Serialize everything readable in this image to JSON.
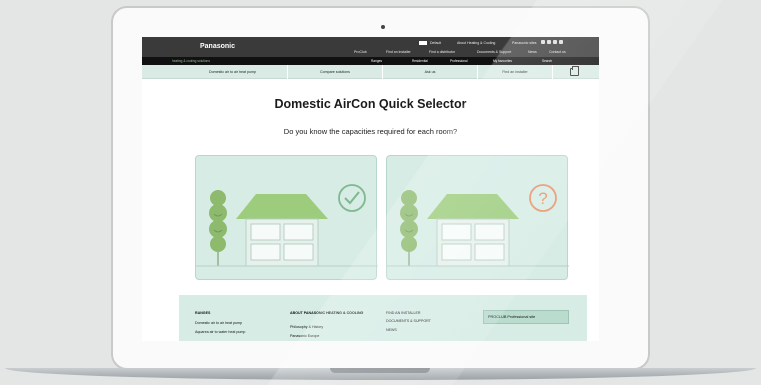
{
  "header": {
    "logo": "Panasonic",
    "top_links": [
      "Default",
      "About Heating & Cooling",
      "Panasonic sites"
    ],
    "secondary_links": [
      "ProClub",
      "Find an installer",
      "Find a distributor",
      "Documents & Support",
      "News",
      "Contact us"
    ],
    "tagline": "heating & cooling solutions",
    "sub_links": [
      "Ranges",
      "Residential",
      "Professional",
      "My favourites",
      "Search"
    ]
  },
  "nav": {
    "items": [
      "Domestic air to air heat pump",
      "Compare solutions",
      "Ask us",
      "Find an installer"
    ]
  },
  "main": {
    "title": "Domestic AirCon Quick Selector",
    "question": "Do you know the capacities required for each room?"
  },
  "colors": {
    "accent": "#7fb069",
    "card_bg": "#d6ece5",
    "icon_yes": "#7fb88f",
    "icon_no": "#e8946a"
  },
  "icons": {
    "option_yes": "check-circle-icon",
    "option_no": "question-circle-icon"
  },
  "footer": {
    "col1_heading": "RANGES",
    "col1_links": [
      "Domestic air to air heat pump",
      "Aquarea air to water heat pump"
    ],
    "col2_heading": "ABOUT PANASONIC HEATING & COOLING",
    "col2_links": [
      "Philosophy & History",
      "Panasonic Europe"
    ],
    "col3_heading": "FIND AN INSTALLER",
    "col3_links": [
      "DOCUMENTS & SUPPORT",
      "NEWS"
    ],
    "proclub": "PROCLUB Professional site"
  }
}
